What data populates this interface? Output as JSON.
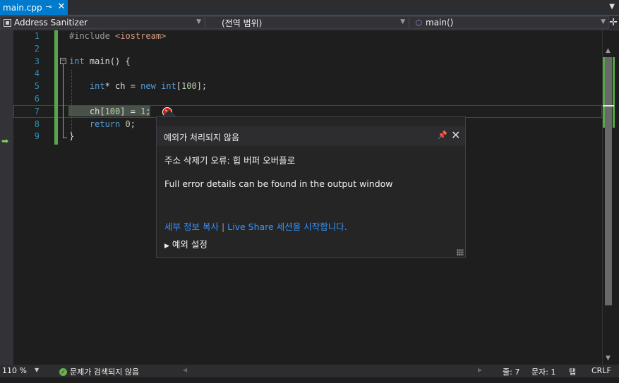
{
  "tab": {
    "filename": "main.cpp",
    "pin_glyph": "⊸",
    "close_glyph": "✕"
  },
  "navbar": {
    "project": "Address Sanitizer",
    "scope": "(전역 범위)",
    "member": "main()"
  },
  "editor": {
    "line_numbers": [
      "1",
      "2",
      "3",
      "4",
      "5",
      "6",
      "7",
      "8",
      "9"
    ],
    "lines": [
      {
        "parts": [
          {
            "t": "#include ",
            "c": "pre"
          },
          {
            "t": "<iostream>",
            "c": "str"
          }
        ]
      },
      {
        "parts": []
      },
      {
        "parts": [
          {
            "t": "int",
            "c": "kw"
          },
          {
            "t": " main() {",
            "c": ""
          }
        ]
      },
      {
        "parts": []
      },
      {
        "parts": [
          {
            "t": "    ",
            "c": ""
          },
          {
            "t": "int",
            "c": "kw"
          },
          {
            "t": "* ch = ",
            "c": ""
          },
          {
            "t": "new",
            "c": "kw"
          },
          {
            "t": " ",
            "c": ""
          },
          {
            "t": "int",
            "c": "kw"
          },
          {
            "t": "[",
            "c": ""
          },
          {
            "t": "100",
            "c": "num"
          },
          {
            "t": "];",
            "c": ""
          }
        ]
      },
      {
        "parts": []
      },
      {
        "parts": [
          {
            "t": "    ch[",
            "c": ""
          },
          {
            "t": "100",
            "c": "num"
          },
          {
            "t": "] = ",
            "c": ""
          },
          {
            "t": "1",
            "c": "num"
          },
          {
            "t": ";",
            "c": ""
          }
        ]
      },
      {
        "parts": [
          {
            "t": "    ",
            "c": ""
          },
          {
            "t": "return",
            "c": "kw"
          },
          {
            "t": " ",
            "c": ""
          },
          {
            "t": "0",
            "c": "num"
          },
          {
            "t": ";",
            "c": ""
          }
        ]
      },
      {
        "parts": [
          {
            "t": "}",
            "c": ""
          }
        ]
      }
    ]
  },
  "popup": {
    "title": "예외가 처리되지 않음",
    "error": "주소 삭제기 오류: 힙 버퍼 오버플로",
    "detail": "Full error details can be found in the output window",
    "link_copy": "세부 정보 복사",
    "link_liveshare": "Live Share 세션을 시작합니다.",
    "settings": "예외 설정"
  },
  "status": {
    "zoom": "110 %",
    "issues": "문제가 검색되지 않음",
    "line": "줄: 7",
    "col": "문자: 1",
    "tab_mode": "탭",
    "eol": "CRLF"
  },
  "colors": {
    "accent": "#007acc",
    "keyword": "#569cd6",
    "number": "#b5cea8",
    "string": "#d69d85",
    "link": "#3794ff",
    "error": "#e51400"
  }
}
